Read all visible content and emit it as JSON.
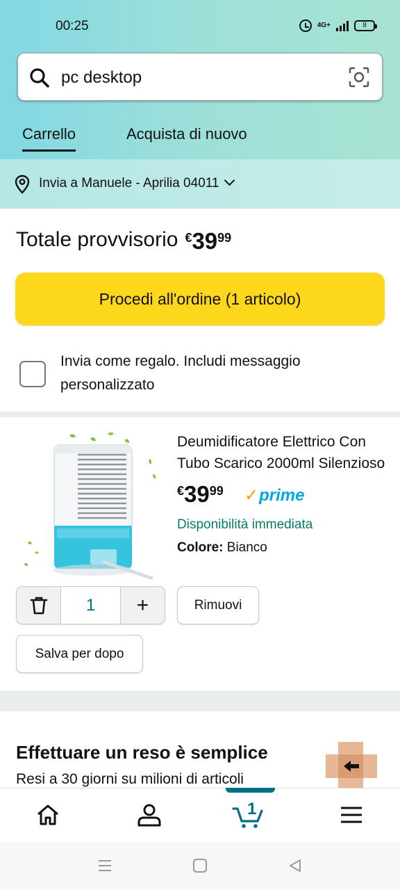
{
  "status_bar": {
    "time": "00:25",
    "network": "4G+",
    "battery": "8",
    "icons": [
      "alarm-icon",
      "signal-icon",
      "battery-icon"
    ]
  },
  "search": {
    "value": "pc desktop",
    "icons": [
      "search-icon",
      "camera-lens-icon"
    ]
  },
  "tabs": [
    {
      "label": "Carrello",
      "active": true
    },
    {
      "label": "Acquista di nuovo",
      "active": false
    }
  ],
  "delivery": {
    "text": "Invia a Manuele - Aprilia 04011"
  },
  "subtotal": {
    "label": "Totale provvisorio",
    "currency": "€",
    "integer": "39",
    "decimal": "99"
  },
  "checkout": {
    "label": "Procedi all'ordine (1 articolo)"
  },
  "gift": {
    "label": "Invia come regalo. Includi messaggio personalizzato",
    "checked": false
  },
  "item": {
    "title": "Deumidificatore Elettrico Con Tubo Scarico 2000ml Silenzioso",
    "price_currency": "€",
    "price_integer": "39",
    "price_decimal": "99",
    "prime_label": "prime",
    "availability": "Disponibilità immediata",
    "color_label": "Colore:",
    "color_value": "Bianco",
    "quantity": "1",
    "plus_label": "+",
    "remove_label": "Rimuovi",
    "save_label": "Salva per dopo"
  },
  "returns": {
    "title": "Effettuare un reso è semplice",
    "subtitle": "Resi a 30 giorni su milioni di articoli"
  },
  "bottom_nav": {
    "items": [
      "home-icon",
      "account-icon",
      "cart-icon",
      "menu-icon"
    ],
    "cart_count": "1",
    "active": "cart"
  },
  "colors": {
    "checkout_button": "#fcd71b",
    "link_teal": "#007185",
    "availability_green": "#067d62",
    "prime_blue": "#00a8e1"
  }
}
